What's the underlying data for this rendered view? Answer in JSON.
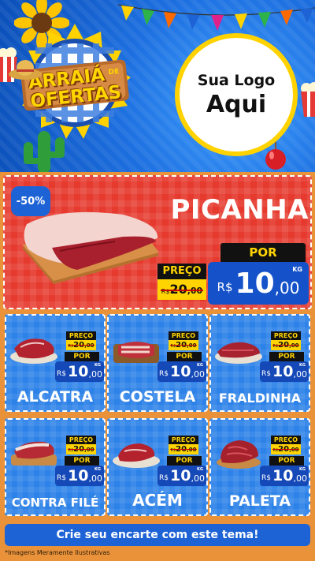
{
  "header": {
    "seal_title_line1": "ARRAIÁ",
    "seal_title_de": "DE",
    "seal_title_line2": "OFERTAS",
    "logo_line1": "Sua Logo",
    "logo_line2": "Aqui"
  },
  "featured": {
    "discount": "-50%",
    "name": "PICANHA",
    "preco_label": "PREÇO",
    "old_currency": "R$",
    "old_int": "20",
    "old_cents": ",00",
    "por_label": "POR",
    "currency": "R$",
    "price_int": "10",
    "price_cents": ",00",
    "unit": "KG"
  },
  "products": [
    {
      "name": "ALCATRA",
      "preco_label": "PREÇO",
      "old_currency": "R$",
      "old_int": "20",
      "old_cents": ",00",
      "por_label": "POR",
      "currency": "R$",
      "price_int": "10",
      "price_cents": ",00",
      "unit": "KG"
    },
    {
      "name": "COSTELA",
      "preco_label": "PREÇO",
      "old_currency": "R$",
      "old_int": "20",
      "old_cents": ",00",
      "por_label": "POR",
      "currency": "R$",
      "price_int": "10",
      "price_cents": ",00",
      "unit": "KG"
    },
    {
      "name": "FRALDINHA",
      "preco_label": "PREÇO",
      "old_currency": "R$",
      "old_int": "20",
      "old_cents": ",00",
      "por_label": "POR",
      "currency": "R$",
      "price_int": "10",
      "price_cents": ",00",
      "unit": "KG"
    },
    {
      "name": "CONTRA FILÉ",
      "preco_label": "PREÇO",
      "old_currency": "R$",
      "old_int": "20",
      "old_cents": ",00",
      "por_label": "POR",
      "currency": "R$",
      "price_int": "10",
      "price_cents": ",00",
      "unit": "KG"
    },
    {
      "name": "ACÉM",
      "preco_label": "PREÇO",
      "old_currency": "R$",
      "old_int": "20",
      "old_cents": ",00",
      "por_label": "POR",
      "currency": "R$",
      "price_int": "10",
      "price_cents": ",00",
      "unit": "KG"
    },
    {
      "name": "PALETA",
      "preco_label": "PREÇO",
      "old_currency": "R$",
      "old_int": "20",
      "old_cents": ",00",
      "por_label": "POR",
      "currency": "R$",
      "price_int": "10",
      "price_cents": ",00",
      "unit": "KG"
    }
  ],
  "footer": {
    "cta_label": "Crie seu encarte com este tema!",
    "disclaimer": "*Imagens Meramente Ilustrativas"
  },
  "colors": {
    "header_blue": "#1d6fe0",
    "featured_red": "#e63a2e",
    "card_blue": "#2d82e8",
    "price_yellow": "#ffd400",
    "background_orange": "#e9923a"
  },
  "icons": [
    "sunflower-icon",
    "straw-hat-icon",
    "popcorn-icon",
    "cactus-icon",
    "candy-apple-icon",
    "bunting-flags-icon"
  ]
}
